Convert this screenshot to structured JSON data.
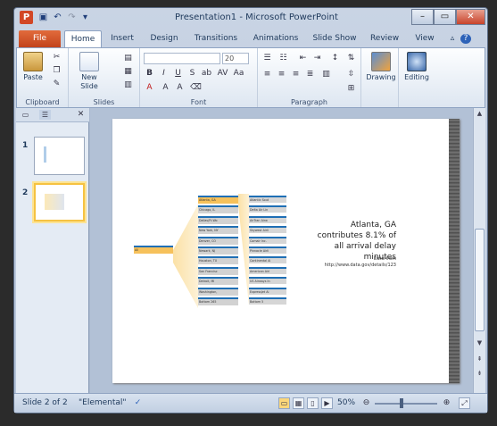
{
  "window": {
    "title": "Presentation1 - Microsoft PowerPoint"
  },
  "tabs": [
    "File",
    "Home",
    "Insert",
    "Design",
    "Transitions",
    "Animations",
    "Slide Show",
    "Review",
    "View"
  ],
  "ribbon": {
    "clipboard": {
      "label": "Clipboard",
      "paste": "Paste"
    },
    "slides": {
      "label": "Slides",
      "new_slide": "New Slide"
    },
    "font": {
      "label": "Font",
      "size": "20"
    },
    "paragraph": {
      "label": "Paragraph"
    },
    "drawing": {
      "label": "Drawing"
    },
    "editing": {
      "label": "Editing"
    }
  },
  "slides_panel": {
    "items": [
      {
        "number": "1"
      },
      {
        "number": "2"
      }
    ]
  },
  "slide": {
    "caption": "Atlanta, GA contributes 8.1% of all arrival delay minutes",
    "source_line1": "Data from",
    "source_line2": "http://www.data.gov/details/123",
    "root_node": "All",
    "level1": [
      "Atlanta, GA",
      "Chicago, IL",
      "Dallas/Ft.Wo",
      "New York, NY",
      "Denver, CO",
      "Newark, NJ",
      "Houston, TX",
      "San Francisc",
      "Detroit, MI",
      "Washington,",
      "Bottom 265"
    ],
    "level2": [
      "Atlantic Sout",
      "Delta Air Lin",
      "AirTran Airw",
      "Skywest Airli",
      "Comair Inc.",
      "Pinnacle Airli",
      "Continental Ai",
      "American Airl",
      "US Airways In",
      "ExpressJet Ai",
      "Bottom 5"
    ]
  },
  "status": {
    "slide_info": "Slide 2 of 2",
    "theme": "\"Elemental\"",
    "zoom": "50%"
  },
  "colors": {
    "file_tab": "#c2431b",
    "highlight": "#f6c15b",
    "bar_blue": "#1f6fb5"
  }
}
